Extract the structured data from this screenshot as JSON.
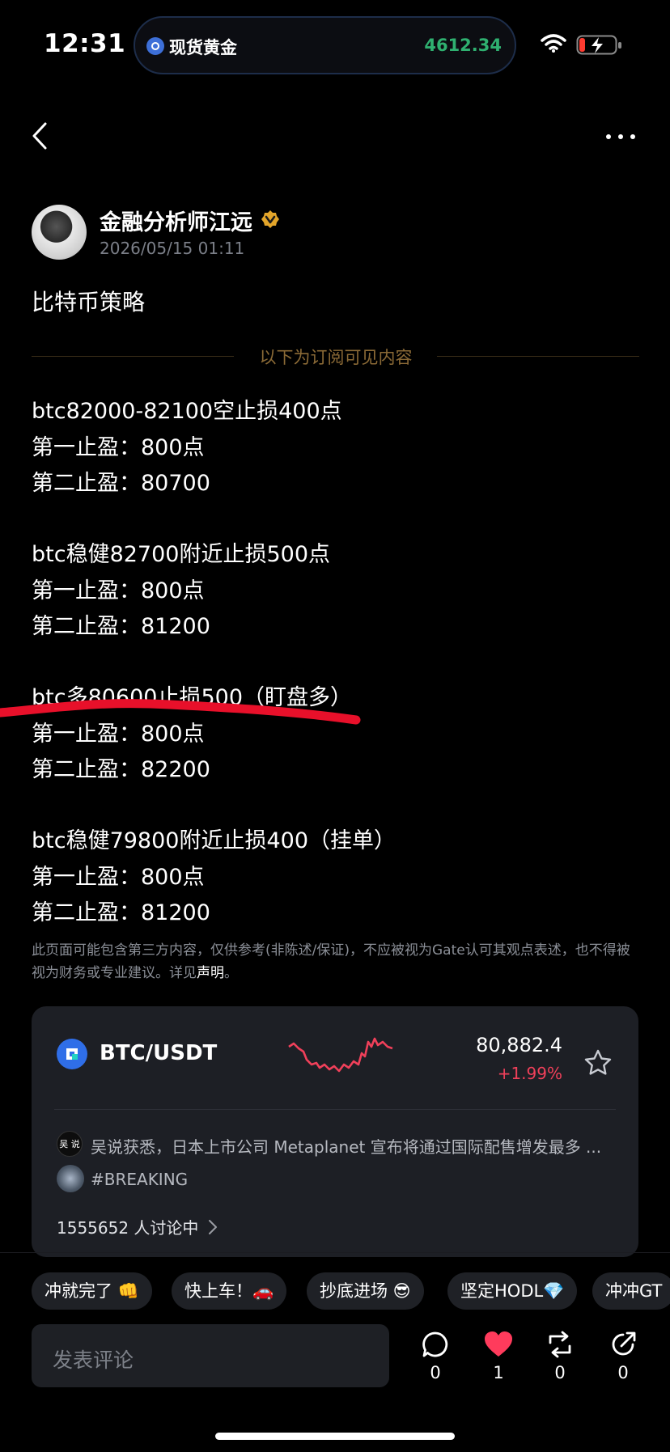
{
  "status_bar": {
    "time": "12:31",
    "island_label": "现货黄金",
    "island_value": "4612.34"
  },
  "author": {
    "name": "金融分析师江远",
    "date": "2026/05/15 01:11"
  },
  "post": {
    "title": "比特币策略",
    "divider_text": "以下为订阅可见内容",
    "lines": [
      "btc82000-82100空止损400点",
      "第一止盈：800点",
      "第二止盈：80700",
      "btc稳健82700附近止损500点",
      "第一止盈：800点",
      "第二止盈：81200",
      "btc多80600止损500（盯盘多）",
      "第一止盈：800点",
      "第二止盈：82200",
      "btc稳健79800附近止损400（挂单）",
      "第一止盈：800点",
      "第二止盈：81200"
    ],
    "disclaimer": "此页面可能包含第三方内容，仅供参考(非陈述/保证)，不应被视为Gate认可其观点表述，也不得被视为财务或专业建议。详见",
    "disclaimer_link": "声明",
    "disclaimer_end": "。"
  },
  "ticker": {
    "pair": "BTC/USDT",
    "price": "80,882.4",
    "change": "+1.99%",
    "news_avatar": "吴 说",
    "news": "吴说获悉，日本上市公司 Metaplanet 宣布将通过国际配售增发最多 ...",
    "tag": "#BREAKING",
    "discussing": "1555652 人讨论中"
  },
  "quick_replies": [
    "冲就完了 👊",
    "快上车！🚗",
    "抄底进场 😎",
    "坚定HODL💎",
    "冲冲GT"
  ],
  "comment": {
    "placeholder": "发表评论"
  },
  "actions": {
    "comments": "0",
    "likes": "1",
    "reposts": "0",
    "shares": "0"
  },
  "colors": {
    "accent_gold": "#8b6a36",
    "price_down_red": "#f0405a",
    "island_green": "#2fb070",
    "like_red": "#ff3b5c"
  }
}
